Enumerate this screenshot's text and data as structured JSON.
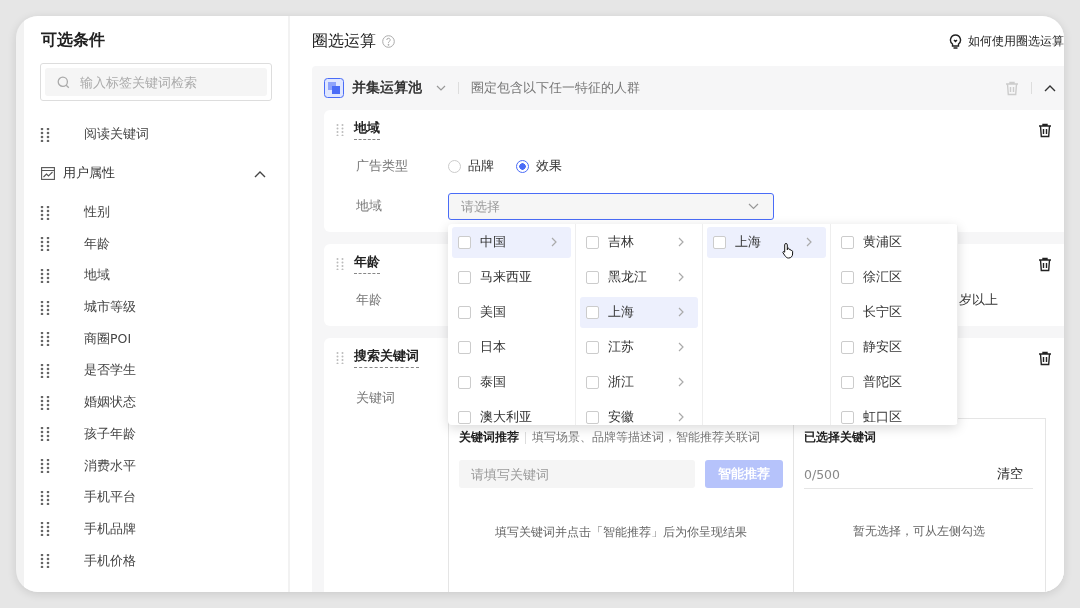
{
  "sidebar": {
    "title": "可选条件",
    "search": {
      "placeholder": "输入标签关键词检索"
    },
    "items": [
      {
        "kind": "item",
        "label": "阅读关键词"
      },
      {
        "kind": "group",
        "label": "用户属性",
        "expanded": true,
        "children": [
          {
            "label": "性别"
          },
          {
            "label": "年龄"
          },
          {
            "label": "地域"
          },
          {
            "label": "城市等级"
          },
          {
            "label": "商圈POI"
          },
          {
            "label": "是否学生"
          },
          {
            "label": "婚姻状态"
          },
          {
            "label": "孩子年龄"
          },
          {
            "label": "消费水平"
          },
          {
            "label": "手机平台"
          },
          {
            "label": "手机品牌"
          },
          {
            "label": "手机价格"
          }
        ]
      }
    ]
  },
  "main": {
    "title": "圈选运算",
    "help_link": "如何使用圈选运算",
    "pool": {
      "name": "并集运算池",
      "description": "圈定包含以下任一特征的人群",
      "expanded": true,
      "cards": [
        {
          "title": "地域",
          "fields": [
            {
              "kind": "radio",
              "label": "广告类型",
              "options": [
                {
                  "label": "品牌",
                  "selected": false
                },
                {
                  "label": "效果",
                  "selected": true
                }
              ]
            },
            {
              "kind": "select",
              "label": "地域",
              "placeholder": "请选择",
              "open": true,
              "cascader": [
                [
                  {
                    "label": "中国",
                    "checked": false,
                    "selected": true,
                    "has_children": true
                  },
                  {
                    "label": "马来西亚",
                    "checked": false,
                    "selected": false,
                    "has_children": false
                  },
                  {
                    "label": "美国",
                    "checked": false,
                    "selected": false,
                    "has_children": false
                  },
                  {
                    "label": "日本",
                    "checked": false,
                    "selected": false,
                    "has_children": false
                  },
                  {
                    "label": "泰国",
                    "checked": false,
                    "selected": false,
                    "has_children": false
                  },
                  {
                    "label": "澳大利亚",
                    "checked": false,
                    "selected": false,
                    "has_children": false
                  }
                ],
                [
                  {
                    "label": "吉林",
                    "checked": false,
                    "selected": false,
                    "has_children": true
                  },
                  {
                    "label": "黑龙江",
                    "checked": false,
                    "selected": false,
                    "has_children": true
                  },
                  {
                    "label": "上海",
                    "checked": false,
                    "selected": true,
                    "has_children": true
                  },
                  {
                    "label": "江苏",
                    "checked": false,
                    "selected": false,
                    "has_children": true
                  },
                  {
                    "label": "浙江",
                    "checked": false,
                    "selected": false,
                    "has_children": true
                  },
                  {
                    "label": "安徽",
                    "checked": false,
                    "selected": false,
                    "has_children": true
                  }
                ],
                [
                  {
                    "label": "上海",
                    "checked": false,
                    "selected": true,
                    "has_children": true
                  }
                ],
                [
                  {
                    "label": "黄浦区",
                    "checked": false,
                    "selected": false,
                    "has_children": false
                  },
                  {
                    "label": "徐汇区",
                    "checked": false,
                    "selected": false,
                    "has_children": false
                  },
                  {
                    "label": "长宁区",
                    "checked": false,
                    "selected": false,
                    "has_children": false
                  },
                  {
                    "label": "静安区",
                    "checked": false,
                    "selected": false,
                    "has_children": false
                  },
                  {
                    "label": "普陀区",
                    "checked": false,
                    "selected": false,
                    "has_children": false
                  },
                  {
                    "label": "虹口区",
                    "checked": false,
                    "selected": false,
                    "has_children": false
                  }
                ]
              ]
            }
          ]
        },
        {
          "title": "年龄",
          "fields": [
            {
              "kind": "text",
              "label": "年龄",
              "value": "岁以上"
            }
          ]
        },
        {
          "title": "搜索关键词",
          "fields": [
            {
              "kind": "keywords",
              "label": "关键词",
              "recommend": {
                "title": "关键词推荐",
                "hint": "填写场景、品牌等描述词，智能推荐关联词",
                "placeholder": "请填写关键词",
                "button": "智能推荐",
                "button_disabled": true,
                "empty": "填写关键词并点击「智能推荐」后为你呈现结果"
              },
              "selected": {
                "title": "已选择关键词",
                "count": "0/500",
                "clear": "清空",
                "empty": "暂无选择，可从左侧勾选"
              }
            }
          ]
        }
      ]
    }
  }
}
